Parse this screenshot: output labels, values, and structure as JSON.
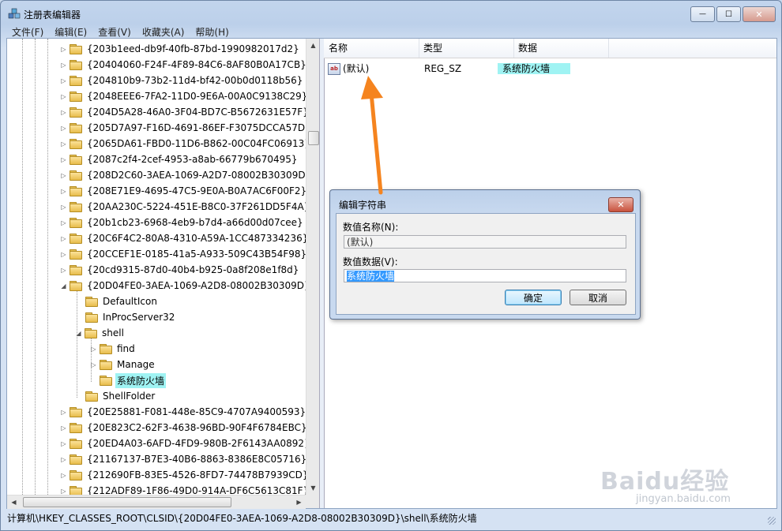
{
  "window": {
    "title": "注册表编辑器",
    "minimize_glyph": "—",
    "maximize_glyph": "☐",
    "close_glyph": "✕"
  },
  "menu": [
    "文件(F)",
    "编辑(E)",
    "查看(V)",
    "收藏夹(A)",
    "帮助(H)"
  ],
  "tree": {
    "guid_keys_before": [
      "{203b1eed-db9f-40fb-87bd-1990982017d2}",
      "{20404060-F24F-4F89-84C6-8AF80B0A17CB}",
      "{204810b9-73b2-11d4-bf42-00b0d0118b56}",
      "{2048EEE6-7FA2-11D0-9E6A-00A0C9138C29}",
      "{204D5A28-46A0-3F04-BD7C-B5672631E57F}",
      "{205D7A97-F16D-4691-86EF-F3075DCCA57D}",
      "{2065DA61-FBD0-11D6-B862-00C04FC06913}",
      "{2087c2f4-2cef-4953-a8ab-66779b670495}",
      "{208D2C60-3AEA-1069-A2D7-08002B30309D}",
      "{208E71E9-4695-47C5-9E0A-B0A7AC6F00F2}",
      "{20AA230C-5224-451E-B8C0-37F261DD5F4A}",
      "{20b1cb23-6968-4eb9-b7d4-a66d00d07cee}",
      "{20C6F4C2-80A8-4310-A59A-1CC487334236}",
      "{20CCEF1E-0185-41a5-A933-509C43B54F98}",
      "{20cd9315-87d0-40b4-b925-0a8f208e1f8d}"
    ],
    "expanded_key": "{20D04FE0-3AEA-1069-A2D8-08002B30309D}",
    "expanded_children": {
      "default_icon": "DefaultIcon",
      "inproc_server": "InProcServer32",
      "shell": "shell",
      "shell_children": [
        "find",
        "Manage",
        "系统防火墙"
      ],
      "shell_folder": "ShellFolder"
    },
    "guid_keys_after": [
      "{20E25881-F081-448e-85C9-4707A9400593}",
      "{20E823C2-62F3-4638-96BD-90F4F6784EBC}",
      "{20ED4A03-6AFD-4FD9-980B-2F6143AA0892}",
      "{21167137-B7E3-40B6-8863-8386E8C05716}",
      "{212690FB-83E5-4526-8FD7-74478B7939CD}",
      "{212ADF89-1F86-49D0-914A-DF6C5613C81F}"
    ],
    "selected_key": "系统防火墙"
  },
  "list": {
    "columns": [
      "名称",
      "类型",
      "数据"
    ],
    "rows": [
      {
        "icon": "ab",
        "name": "(默认)",
        "type": "REG_SZ",
        "data": "系统防火墙"
      }
    ]
  },
  "status": {
    "path": "计算机\\HKEY_CLASSES_ROOT\\CLSID\\{20D04FE0-3AEA-1069-A2D8-08002B30309D}\\shell\\系统防火墙"
  },
  "dialog": {
    "title": "编辑字符串",
    "close_glyph": "✕",
    "value_name_label": "数值名称(N):",
    "value_name": "(默认)",
    "value_data_label": "数值数据(V):",
    "value_data": "系统防火墙",
    "ok": "确定",
    "cancel": "取消"
  },
  "annotation": {
    "arrow_color": "#f5841f"
  },
  "watermark": {
    "text": "Baidu经验",
    "sub": "jingyan.baidu.com"
  },
  "icons": {
    "app": "registry-editor-icon",
    "folder": "folder-icon",
    "string_value": "string-value-icon"
  }
}
